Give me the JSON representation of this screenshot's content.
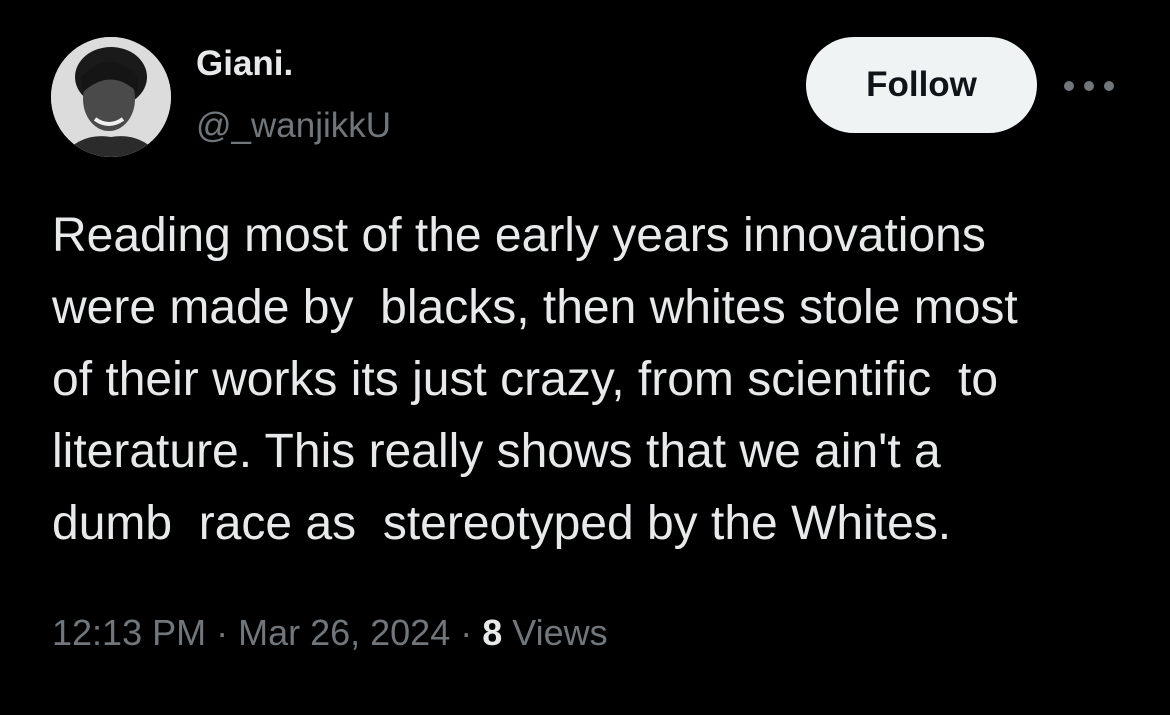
{
  "author": {
    "display_name": "Giani.",
    "handle": "@_wanjikkU"
  },
  "actions": {
    "follow_label": "Follow",
    "more_icon": "ellipsis-icon"
  },
  "tweet": {
    "lines": [
      "Reading most of the early years innovations",
      "were made by  blacks, then whites stole most",
      "of their works its just crazy, from scientific  to",
      "literature. This really shows that we ain't a",
      "dumb  race as  stereotyped by the Whites."
    ]
  },
  "meta": {
    "time": "12:13 PM",
    "separator": " · ",
    "date": "Mar 26, 2024",
    "views_count": "8",
    "views_label": " Views"
  },
  "colors": {
    "background": "#000000",
    "primary_text": "#e7e9ea",
    "secondary_text": "#71767b",
    "follow_button_bg": "#eff3f4",
    "follow_button_text": "#0f1419"
  }
}
